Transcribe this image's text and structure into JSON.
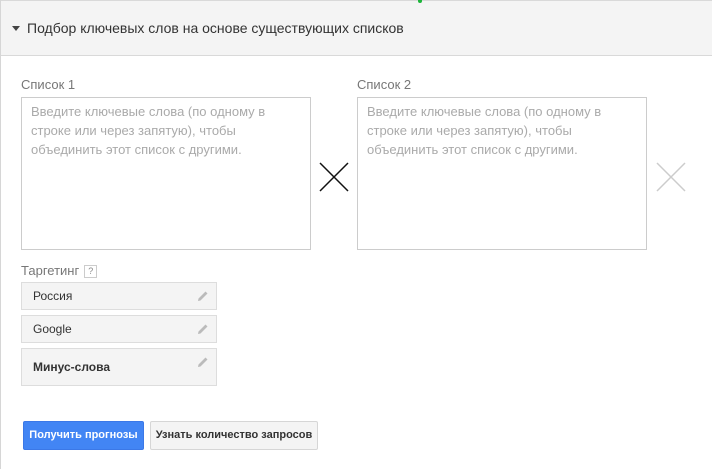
{
  "section": {
    "title": "Подбор ключевых слов на основе существующих списков"
  },
  "lists": [
    {
      "label": "Список 1",
      "placeholder": "Введите ключевые слова (по одному в строке или через запятую), чтобы объединить этот список с другими.",
      "value": ""
    },
    {
      "label": "Список 2",
      "placeholder": "Введите ключевые слова (по одному в строке или через запятую), чтобы объединить этот список с другими.",
      "value": ""
    }
  ],
  "targeting": {
    "label": "Таргетинг",
    "help": "?",
    "items": [
      {
        "label": "Россия"
      },
      {
        "label": "Google"
      },
      {
        "label": "Минус-слова"
      }
    ]
  },
  "buttons": {
    "primary": "Получить прогнозы",
    "secondary": "Узнать количество запросов"
  },
  "colors": {
    "primary": "#4285f4",
    "header_bg": "#f4f4f4"
  }
}
